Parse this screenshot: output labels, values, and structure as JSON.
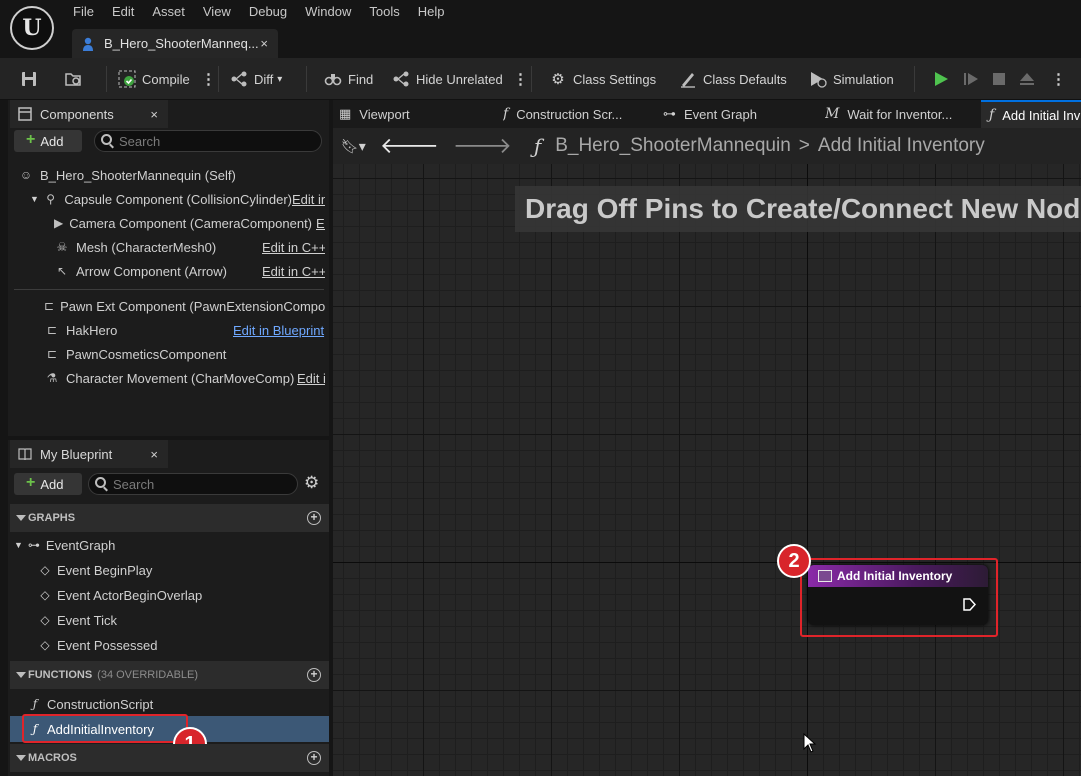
{
  "menu": [
    "File",
    "Edit",
    "Asset",
    "View",
    "Debug",
    "Window",
    "Tools",
    "Help"
  ],
  "document_tab": {
    "title": "B_Hero_ShooterManneq...",
    "close": "×"
  },
  "toolbar": {
    "compile": "Compile",
    "diff": "Diff",
    "find": "Find",
    "hide_unrelated": "Hide Unrelated",
    "class_settings": "Class Settings",
    "class_defaults": "Class Defaults",
    "simulation": "Simulation"
  },
  "components_panel": {
    "title": "Components",
    "close": "×",
    "add_label": "Add",
    "search_placeholder": "Search",
    "items": [
      {
        "label": "B_Hero_ShooterMannequin (Self)",
        "icon": "character-icon",
        "link": ""
      },
      {
        "label": "Capsule Component (CollisionCylinder)",
        "icon": "capsule-icon",
        "link": "Edit in C++"
      },
      {
        "label": "Camera Component (CameraComponent)",
        "icon": "camera-icon",
        "link": "Edit in C++"
      },
      {
        "label": "Mesh (CharacterMesh0)",
        "icon": "skeleton-icon",
        "link": "Edit in C++"
      },
      {
        "label": "Arrow Component (Arrow)",
        "icon": "arrow-icon",
        "link": "Edit in C++"
      },
      {
        "label": "Pawn Ext Component (PawnExtensionComponent)",
        "icon": "component-icon",
        "link": ""
      },
      {
        "label": "HakHero",
        "icon": "component-icon",
        "link": "Edit in Blueprint"
      },
      {
        "label": "PawnCosmeticsComponent",
        "icon": "component-icon",
        "link": ""
      },
      {
        "label": "Character Movement (CharMoveComp)",
        "icon": "movement-icon",
        "link": "Edit in C++"
      }
    ]
  },
  "my_blueprint": {
    "title": "My Blueprint",
    "close": "×",
    "add_label": "Add",
    "search_placeholder": "Search",
    "graphs_header": "GRAPHS",
    "event_graph": "EventGraph",
    "events": [
      "Event BeginPlay",
      "Event ActorBeginOverlap",
      "Event Tick",
      "Event Possessed"
    ],
    "functions_header": "FUNCTIONS",
    "functions_sub": "(34 OVERRIDABLE)",
    "functions": [
      "ConstructionScript",
      "AddInitialInventory"
    ],
    "macros_header": "MACROS"
  },
  "graph_tabs": [
    {
      "label": "Viewport",
      "icon": "viewport-icon"
    },
    {
      "label": "Construction Scr...",
      "icon": "function-icon"
    },
    {
      "label": "Event Graph",
      "icon": "event-graph-icon"
    },
    {
      "label": "Wait for Inventor...",
      "icon": "macro-icon"
    },
    {
      "label": "Add Initial Inv",
      "icon": "function-icon"
    }
  ],
  "breadcrumb": {
    "root": "B_Hero_ShooterMannequin",
    "separator": ">",
    "current": "Add Initial Inventory"
  },
  "graph": {
    "hint": "Drag Off Pins to Create/Connect New Nodes",
    "node_title": "Add Initial Inventory"
  },
  "badges": {
    "one": "1",
    "two": "2"
  },
  "colors": {
    "highlight": "#e0242a",
    "accent": "#0070e0",
    "node_header": "#8a2aa8",
    "add_plus": "#6cc24a"
  }
}
